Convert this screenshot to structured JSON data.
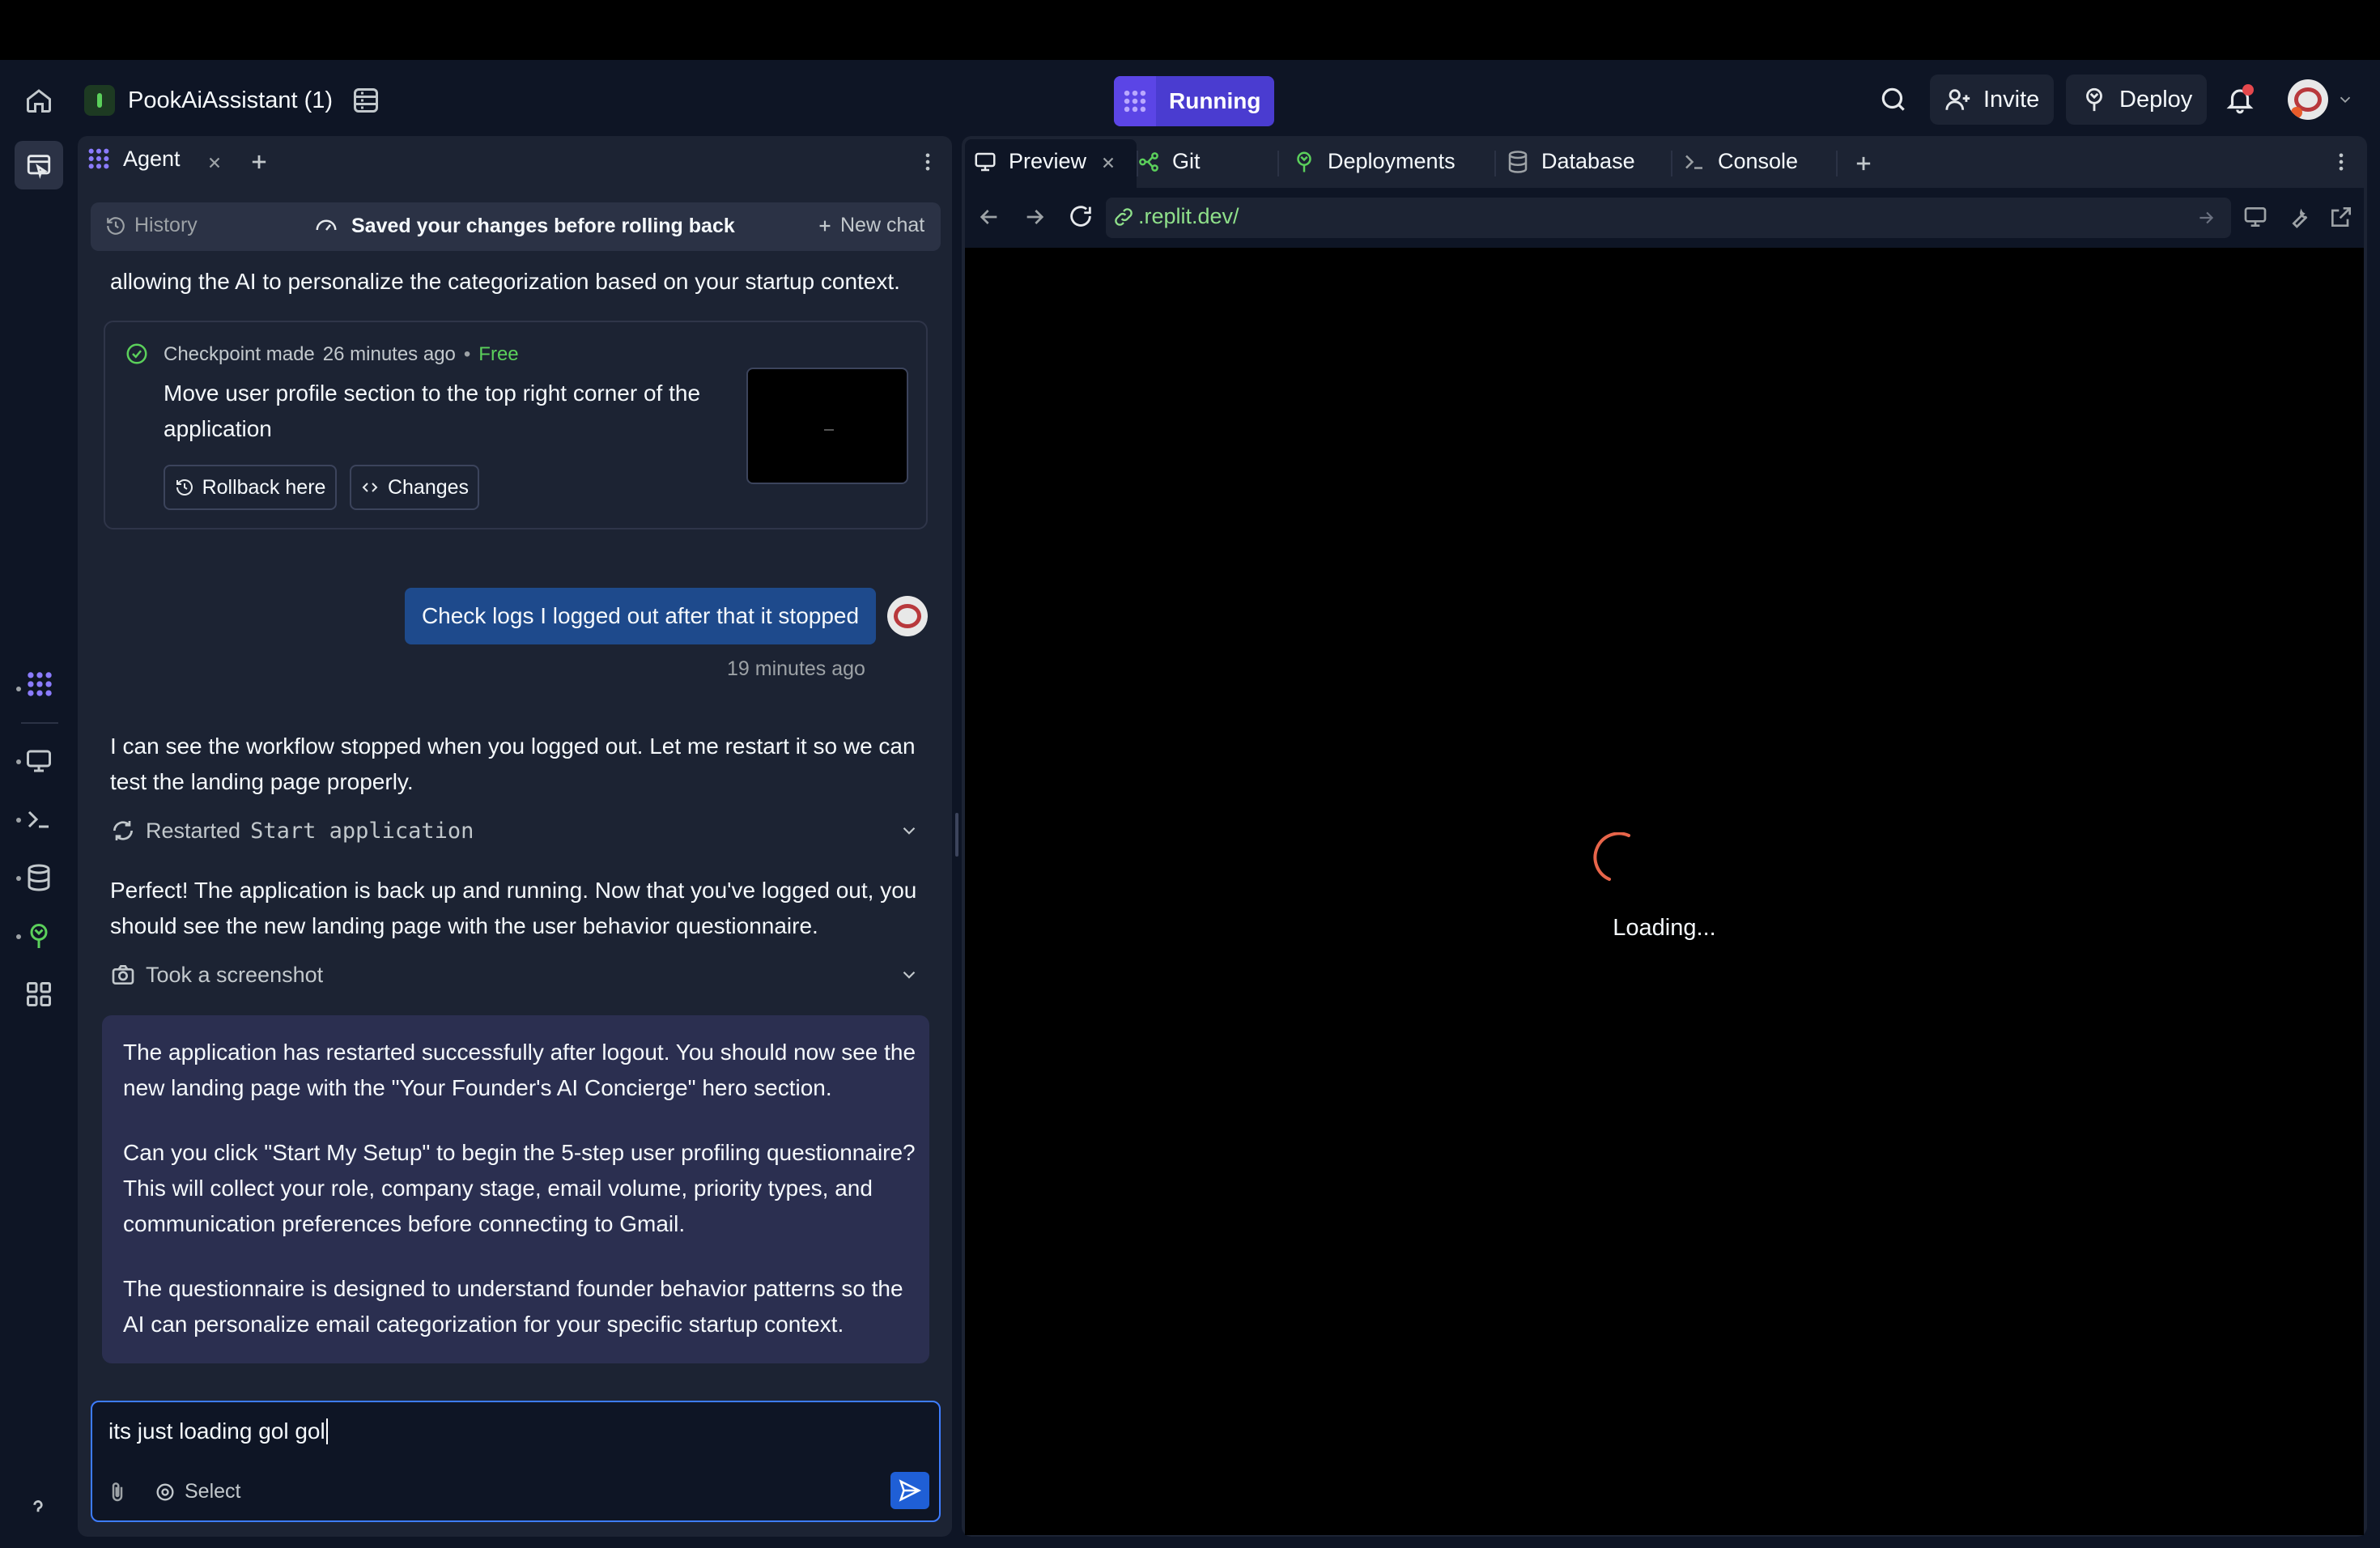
{
  "header": {
    "project_name": "PookAiAssistant (1)",
    "run_label": "Running",
    "invite_label": "Invite",
    "deploy_label": "Deploy"
  },
  "agent": {
    "tab_label": "Agent",
    "history_label": "History",
    "status_text": "Saved your changes before rolling back",
    "new_chat_label": "New chat",
    "partial_text": "allowing the AI to personalize the categorization based on your startup context.",
    "checkpoint": {
      "made_label": "Checkpoint made",
      "time": "26 minutes ago",
      "separator": "•",
      "price": "Free",
      "description": "Move user profile section to the top right corner of the application",
      "rollback_label": "Rollback here",
      "changes_label": "Changes"
    },
    "user_message": {
      "text": "Check logs I logged out after that it stopped",
      "time": "19 minutes ago"
    },
    "agent_reply_1": "I can see the workflow stopped when you logged out. Let me restart it so we can test the landing page properly.",
    "action_1": {
      "prefix": "Restarted",
      "code": "Start application"
    },
    "agent_reply_2": "Perfect! The application is back up and running. Now that you've logged out, you should see the new landing page with the user behavior questionnaire.",
    "action_2": "Took a screenshot",
    "final_message": [
      "The application has restarted successfully after logout. You should now see the new landing page with the \"Your Founder's AI Concierge\" hero section.",
      "Can you click \"Start My Setup\" to begin the 5-step user profiling questionnaire? This will collect your role, company stage, email volume, priority types, and communication preferences before connecting to Gmail.",
      "The questionnaire is designed to understand founder behavior patterns so the AI can personalize email categorization for your specific startup context."
    ],
    "input_value": "its just loading gol gol",
    "select_label": "Select"
  },
  "workspace": {
    "tabs": [
      {
        "label": "Preview"
      },
      {
        "label": "Git"
      },
      {
        "label": "Deployments"
      },
      {
        "label": "Database"
      },
      {
        "label": "Console"
      }
    ],
    "url": ".replit.dev/",
    "loading_text": "Loading..."
  },
  "colors": {
    "background": "#0e1525",
    "panel": "#1c2333",
    "accent_purple": "#5b45e6",
    "user_bubble": "#1e4a8c",
    "link_green": "#8fe08a",
    "spinner": "#e8654a"
  }
}
